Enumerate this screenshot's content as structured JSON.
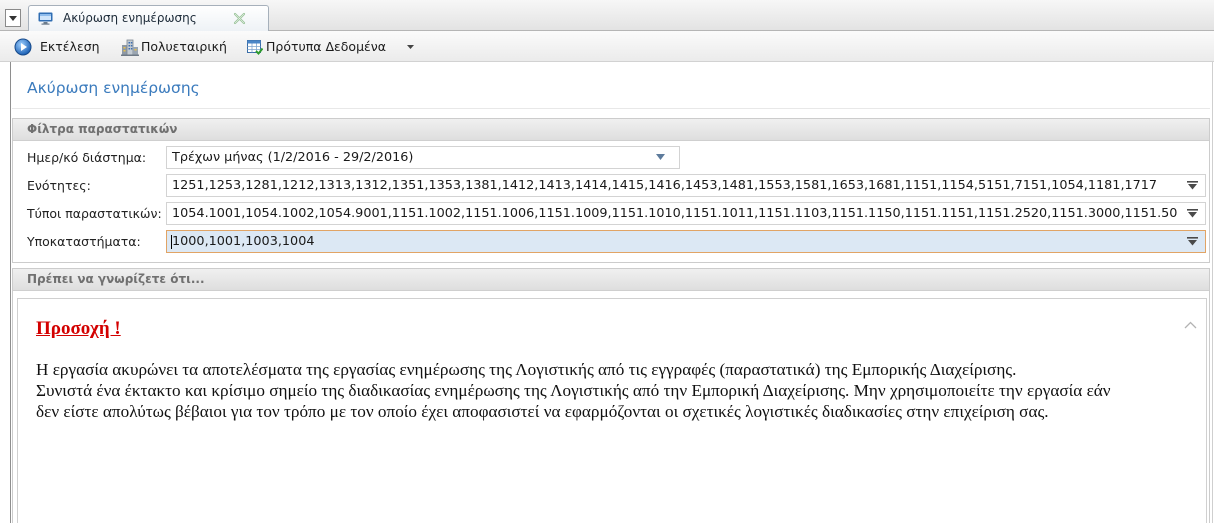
{
  "tabs": [
    {
      "label": "Ακύρωση ενημέρωσης",
      "icon": "monitor-icon",
      "active": true
    }
  ],
  "toolbar": {
    "items": [
      {
        "label": "Εκτέλεση",
        "icon": "play-icon"
      },
      {
        "label": "Πολυεταιρική",
        "icon": "building-icon"
      },
      {
        "label": "Πρότυπα Δεδομένα",
        "icon": "table-icon",
        "has_dropdown": true
      }
    ]
  },
  "page": {
    "title": "Ακύρωση ενημέρωσης"
  },
  "filters": {
    "title": "Φίλτρα παραστατικών",
    "fields": [
      {
        "label": "Ημερ/κό διάστημα:",
        "value": "Τρέχων μήνας (1/2/2016 - 29/2/2016)"
      },
      {
        "label": "Ενότητες:",
        "value": "1251,1253,1281,1212,1313,1312,1351,1353,1381,1412,1413,1414,1415,1416,1453,1481,1553,1581,1653,1681,1151,1154,5151,7151,1054,1181,1717"
      },
      {
        "label": "Τύποι παραστατικών:",
        "value": "1054.1001,1054.1002,1054.9001,1151.1002,1151.1006,1151.1009,1151.1010,1151.1011,1151.1103,1151.1150,1151.1151,1151.2520,1151.3000,1151.50"
      },
      {
        "label": "Υποκαταστήματα:",
        "value": "1000,1001,1003,1004",
        "focused": true
      }
    ]
  },
  "info": {
    "title": "Πρέπει να γνωρίζετε ότι...",
    "warning_title": "Προσοχή !",
    "lines": [
      "Η εργασία ακυρώνει τα αποτελέσματα της εργασίας ενημέρωσης της Λογιστικής από τις εγγραφές (παραστατικά) της Εμπορικής Διαχείρισης.",
      "Συνιστά ένα έκτακτο και κρίσιμο σημείο της διαδικασίας ενημέρωσης της Λογιστικής από την Εμπορική Διαχείρισης. Μην χρησιμοποιείτε την εργασία εάν",
      "δεν είστε απολύτως βέβαιοι για τον τρόπο με τον οποίο έχει αποφασιστεί να εφαρμόζονται οι σχετικές λογιστικές διαδικασίες στην επιχείριση σας."
    ]
  },
  "colors": {
    "accent": "#3b7bbd",
    "warning": "#d30000",
    "focus_border": "#e1a465",
    "focus_background": "#dce8f4",
    "section_header_text": "#707070"
  }
}
